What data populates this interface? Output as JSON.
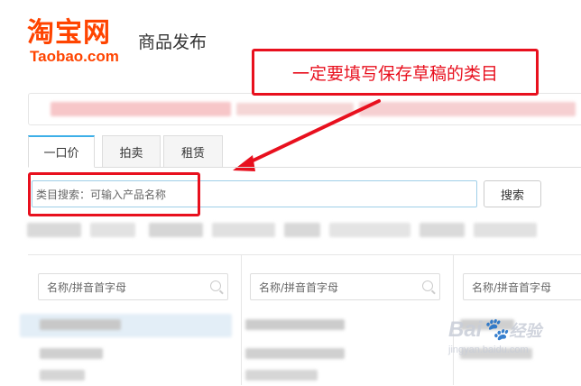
{
  "header": {
    "logo_cn": "淘宝网",
    "logo_en": "Taobao.com",
    "title": "商品发布"
  },
  "annotation": {
    "callout_text": "一定要填写保存草稿的类目",
    "color": "#e8101e"
  },
  "tabs": [
    {
      "label": "一口价",
      "active": true
    },
    {
      "label": "拍卖",
      "active": false
    },
    {
      "label": "租赁",
      "active": false
    }
  ],
  "search": {
    "placeholder": "类目搜索：可输入产品名称",
    "button_label": "搜索"
  },
  "columns": [
    {
      "filter_placeholder": "名称/拼音首字母"
    },
    {
      "filter_placeholder": "名称/拼音首字母"
    },
    {
      "filter_placeholder": "名称/拼音首字母"
    }
  ],
  "watermark": {
    "brand": "Bai",
    "suffix": "经验",
    "url": "jingyan.baidu.com"
  },
  "colors": {
    "brand": "#ff4400",
    "tab_accent": "#3dafe8",
    "annotation": "#e8101e"
  }
}
